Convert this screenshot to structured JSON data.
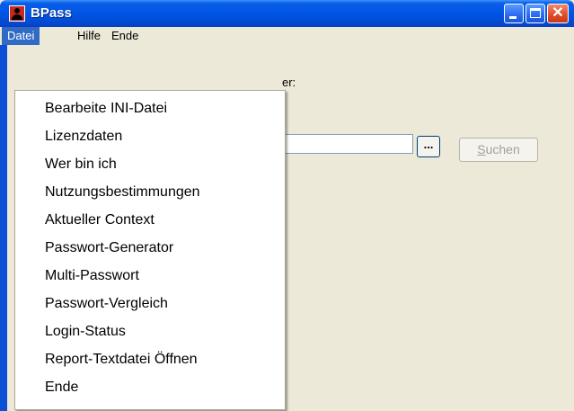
{
  "window": {
    "title": "BPass"
  },
  "colors": {
    "titlebar": "#0055e5",
    "menu_highlight": "#316ac5",
    "window_bg": "#ece9d8"
  },
  "menubar": {
    "items": [
      {
        "label": "Datei"
      },
      {
        "label": "Hilfe"
      },
      {
        "label": "Ende"
      }
    ]
  },
  "main": {
    "label_partial": "er:",
    "browse_label": "...",
    "search_label": "Suchen",
    "search_underline_char": "S",
    "search_rest": "uchen"
  },
  "dropdown": {
    "items": [
      {
        "label": "Bearbeite INI-Datei"
      },
      {
        "label": "Lizenzdaten"
      },
      {
        "label": "Wer bin ich"
      },
      {
        "label": "Nutzungsbestimmungen"
      },
      {
        "label": "Aktueller Context"
      },
      {
        "label": "Passwort-Generator"
      },
      {
        "label": "Multi-Passwort"
      },
      {
        "label": "Passwort-Vergleich"
      },
      {
        "label": "Login-Status"
      },
      {
        "label": "Report-Textdatei Öffnen"
      },
      {
        "label": "Ende"
      }
    ]
  }
}
